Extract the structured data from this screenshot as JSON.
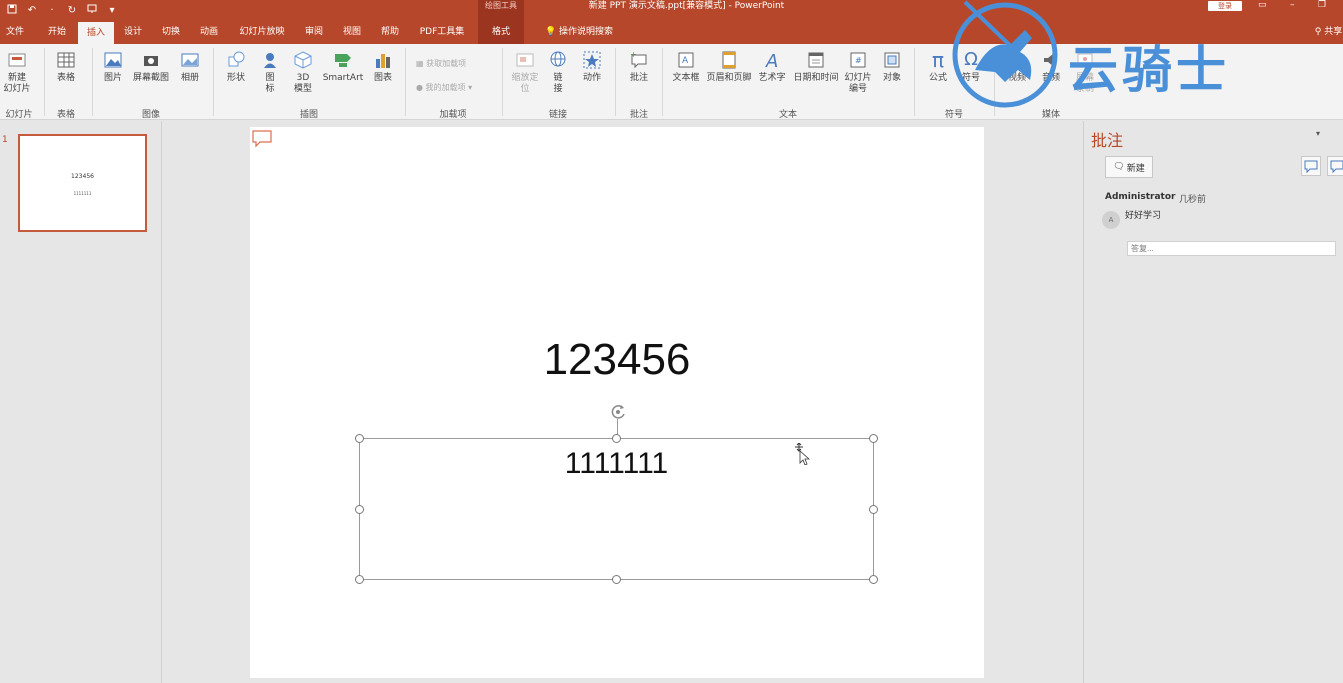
{
  "titlebar": {
    "context_group": "绘图工具",
    "document_title": "新建 PPT 演示文稿.ppt[兼容模式]  -  PowerPoint",
    "login_label": "登录"
  },
  "tabs": {
    "file": "文件",
    "home": "开始",
    "insert": "插入",
    "design": "设计",
    "transitions": "切换",
    "animations": "动画",
    "slideshow": "幻灯片放映",
    "review": "审阅",
    "view": "视图",
    "help": "帮助",
    "pdf": "PDF工具集",
    "format": "格式",
    "tell_me": "操作说明搜索",
    "share": "共享"
  },
  "ribbon": {
    "new_slide": "新建\n幻灯片",
    "table": "表格",
    "picture": "图片",
    "screenshot": "屏幕截图",
    "album": "相册",
    "shapes": "形状",
    "icons": "图\n标",
    "model3d": "3D\n模型",
    "smartart": "SmartArt",
    "chart": "图表",
    "get_addins": "获取加载项",
    "my_addins": "我的加载项",
    "zoom": "缩放定\n位",
    "link": "链\n接",
    "action": "动作",
    "comment": "批注",
    "textbox": "文本框",
    "header_footer": "页眉和页脚",
    "wordart": "艺术字",
    "datetime": "日期和时间",
    "slide_number": "幻灯片\n编号",
    "object": "对象",
    "equation": "公式",
    "symbol": "符号",
    "video": "视频",
    "audio": "音频",
    "screen_record": "屏幕\n录制",
    "groups": {
      "slides": "幻灯片",
      "tables": "表格",
      "images": "图像",
      "illustrations": "插图",
      "addins": "加载项",
      "links": "链接",
      "comments": "批注",
      "text": "文本",
      "symbols": "符号",
      "media": "媒体"
    }
  },
  "watermark": {
    "text": "云骑士"
  },
  "thumbnails": {
    "slide_number": "1",
    "title": "123456",
    "body": "1111111"
  },
  "slide": {
    "title": "123456",
    "textbox": "1111111"
  },
  "comments_pane": {
    "title": "批注",
    "new_label": "新建",
    "author": "Administrator",
    "time": "几秒前",
    "avatar": "A",
    "body": "好好学习",
    "reply_placeholder": "答复..."
  },
  "colors": {
    "accent": "#b7472a",
    "context": "#9c3520",
    "watermark": "#4a90d9"
  }
}
